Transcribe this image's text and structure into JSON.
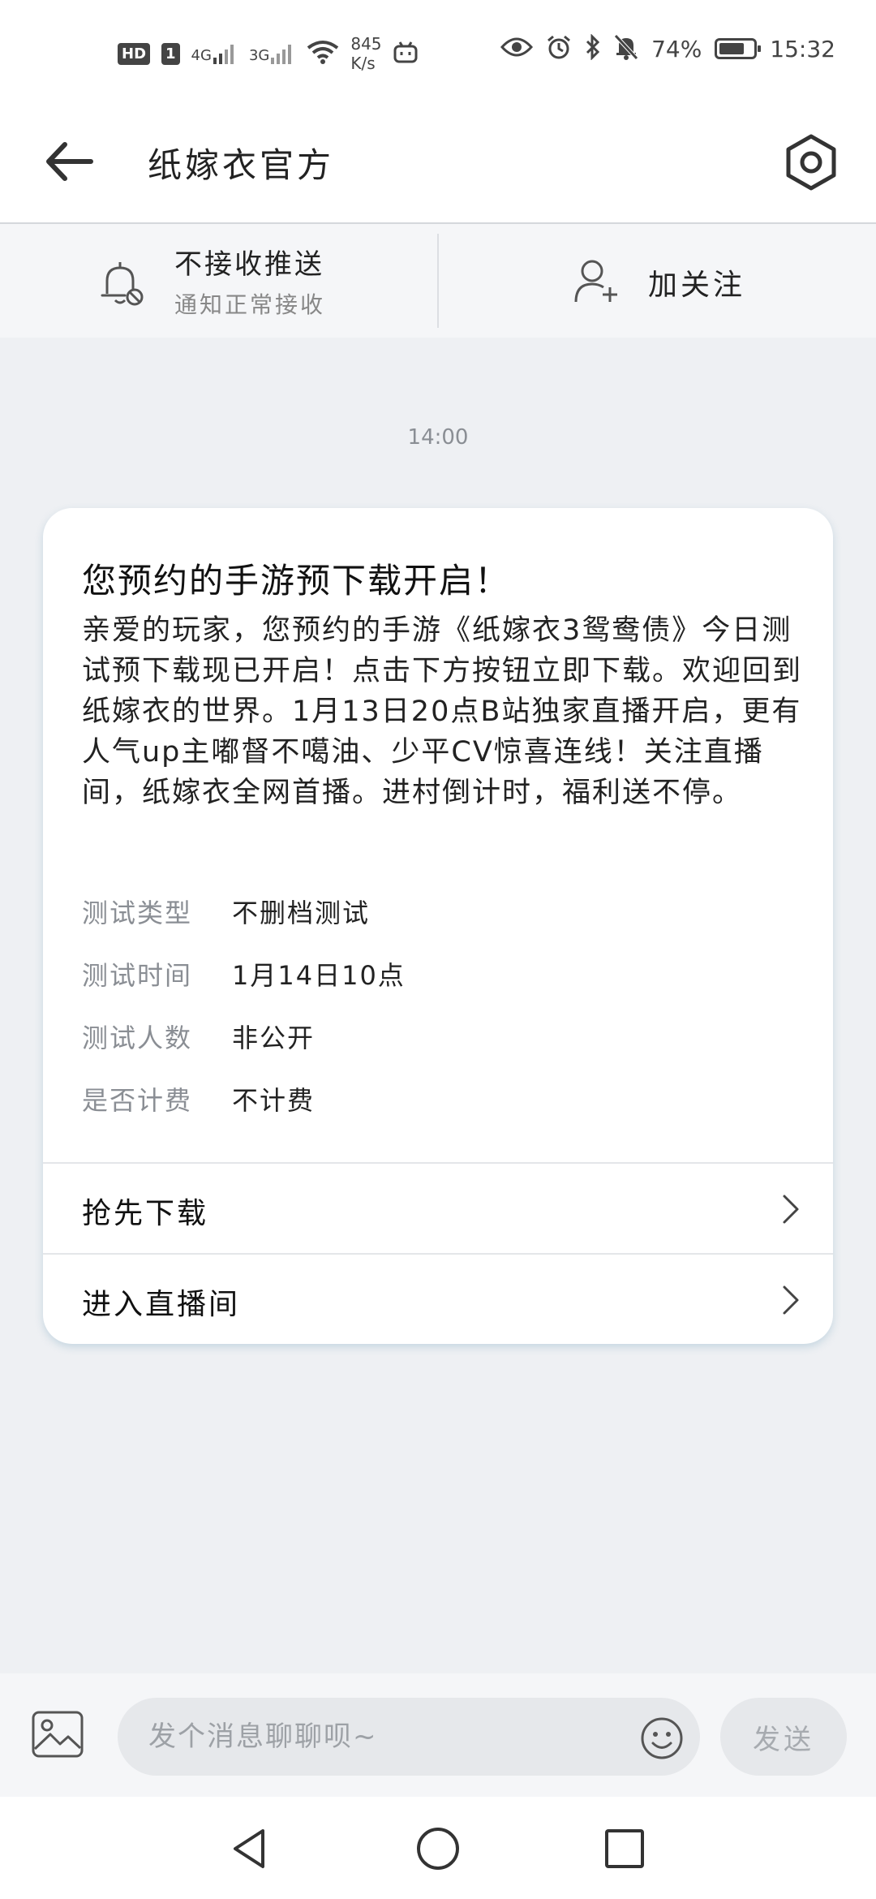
{
  "status_bar": {
    "hd": "HD",
    "sim": "1",
    "net1": "4G",
    "net2": "3G",
    "speed_value": "845",
    "speed_unit": "K/s",
    "battery_text": "74%",
    "battery_level": 0.74,
    "time": "15:32"
  },
  "header": {
    "title": "纸嫁衣官方"
  },
  "subbar": {
    "push_title": "不接收推送",
    "push_subtitle": "通知正常接收",
    "follow_label": "加关注"
  },
  "chat": {
    "timestamp": "14:00"
  },
  "card": {
    "title": "您预约的手游预下载开启！",
    "body": "亲爱的玩家，您预约的手游《纸嫁衣3鸳鸯债》今日测试预下载现已开启！点击下方按钮立即下载。欢迎回到纸嫁衣的世界。1月13日20点B站独家直播开启，更有人气up主嘟督不噶油、少平CV惊喜连线！关注直播间，纸嫁衣全网首播。进村倒计时，福利送不停。",
    "info": [
      {
        "key": "测试类型",
        "value": "不删档测试"
      },
      {
        "key": "测试时间",
        "value": "1月14日10点"
      },
      {
        "key": "测试人数",
        "value": "非公开"
      },
      {
        "key": "是否计费",
        "value": "不计费"
      }
    ],
    "actions": [
      {
        "label": "抢先下载"
      },
      {
        "label": "进入直播间"
      }
    ]
  },
  "input_bar": {
    "placeholder": "发个消息聊聊呗~",
    "value": "",
    "send_label": "发送"
  },
  "icons": {
    "back": "arrow-left-icon",
    "settings": "hexagon-gear-icon",
    "bell": "bell-off-icon",
    "follow": "user-plus-icon",
    "image": "image-icon",
    "emoji": "smiley-icon",
    "chevron": "chevron-right-icon",
    "nav_back": "triangle-back-icon",
    "nav_home": "circle-home-icon",
    "nav_recent": "square-recent-icon"
  },
  "colors": {
    "background": "#eef0f3",
    "card": "#ffffff",
    "muted_text": "#8a8e94",
    "input_fill": "#e6e8eb"
  }
}
